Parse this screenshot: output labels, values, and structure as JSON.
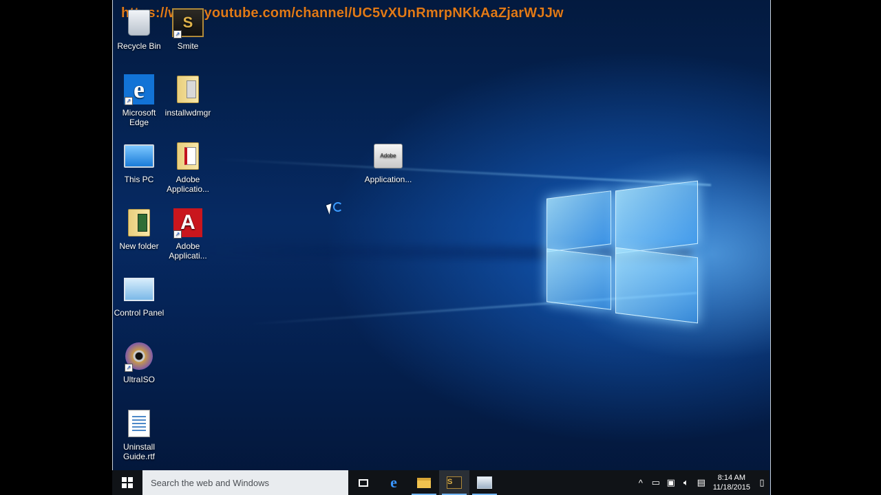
{
  "overlay": {
    "url": "https://www.youtube.com/channel/UC5vXUnRmrpNKkAaZjarWJJw"
  },
  "desktop_icons": [
    {
      "label": "Recycle Bin",
      "icon": "recycle-bin-icon"
    },
    {
      "label": "Smite",
      "icon": "smite-icon"
    },
    {
      "label": "Microsoft Edge",
      "icon": "edge-icon"
    },
    {
      "label": "installwdmgr",
      "icon": "folder-icon"
    },
    {
      "label": "This PC",
      "icon": "computer-icon"
    },
    {
      "label": "Adobe Applicatio...",
      "icon": "folder-icon"
    },
    {
      "label": "New folder",
      "icon": "folder-icon"
    },
    {
      "label": "Adobe Applicati...",
      "icon": "acrobat-icon"
    },
    {
      "label": "Control Panel",
      "icon": "control-panel-icon"
    },
    {
      "label": "UltraISO",
      "icon": "disc-icon"
    },
    {
      "label": "Uninstall Guide.rtf",
      "icon": "document-icon"
    },
    {
      "label": "Application...",
      "icon": "package-icon",
      "badge": "Adobe"
    }
  ],
  "taskbar": {
    "search_placeholder": "Search the web and Windows",
    "apps": [
      "task-view-icon",
      "edge-icon",
      "file-explorer-icon",
      "smite-icon",
      "installer-icon"
    ]
  },
  "tray": {
    "time": "8:14 AM",
    "date": "11/18/2015",
    "chevron": "^"
  },
  "colors": {
    "taskbar": "#101317",
    "url": "#e07a1a",
    "accent": "#76b9ff"
  }
}
